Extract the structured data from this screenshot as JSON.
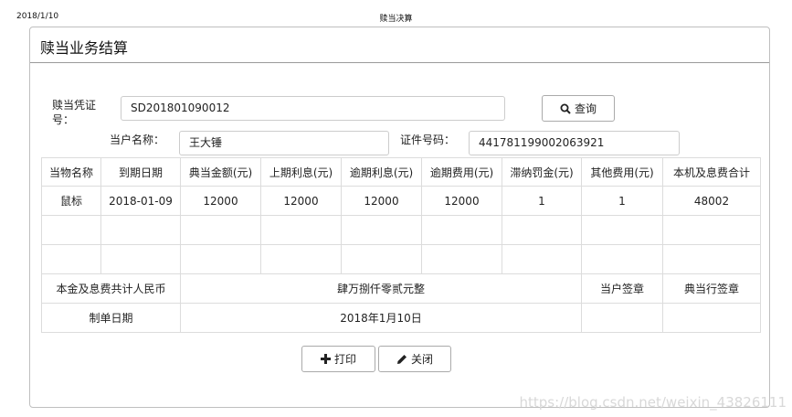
{
  "print_header": {
    "date": "2018/1/10",
    "title": "赎当决算"
  },
  "panel": {
    "title": "赎当业务结算"
  },
  "form": {
    "voucher_label_line1": "赎当凭证",
    "voucher_label_line2": "号：",
    "voucher_value": "SD201801090012",
    "search_label": "查询",
    "pawner_label": "当户名称：",
    "pawner_value": "王大锤",
    "id_label": "证件号码：",
    "id_value": "441781199002063921"
  },
  "table": {
    "headers": [
      "当物名称",
      "到期日期",
      "典当金额(元)",
      "上期利息(元)",
      "逾期利息(元)",
      "逾期费用(元)",
      "滞纳罚金(元)",
      "其他费用(元)",
      "本机及息费合计"
    ],
    "rows": [
      [
        "鼠标",
        "2018-01-09",
        "12000",
        "12000",
        "12000",
        "12000",
        "1",
        "1",
        "48002"
      ]
    ],
    "total_label": "本金及息费共计人民币",
    "total_value": "肆万捌仟零贰元整",
    "customer_sign": "当户签章",
    "shop_sign": "典当行签章",
    "date_label": "制单日期",
    "date_value": "2018年1月10日"
  },
  "actions": {
    "print_label": "打印",
    "close_label": "关闭"
  },
  "watermark": "https://blog.csdn.net/weixin_43826111"
}
